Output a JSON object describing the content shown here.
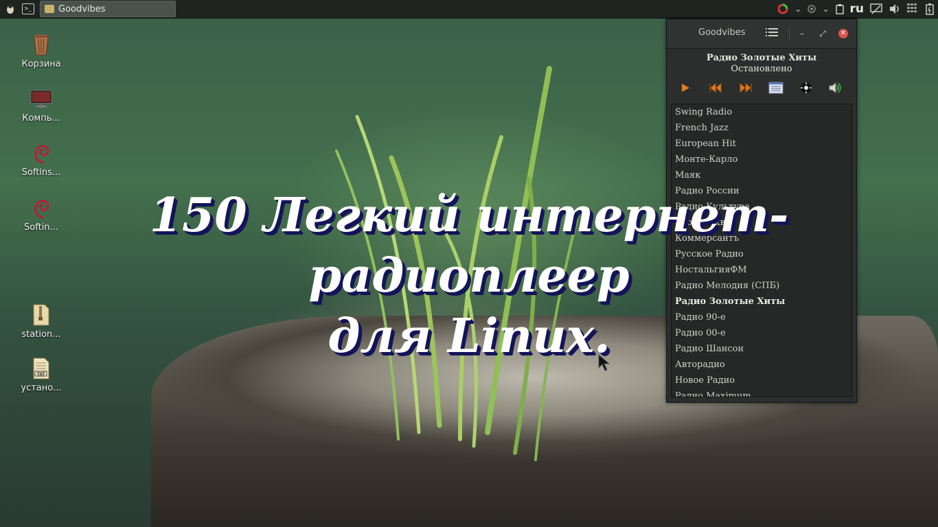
{
  "taskbar": {
    "window_title": "Goodvibes",
    "tray_lang": "ru"
  },
  "desktop": {
    "icons": [
      {
        "label": "Корзина"
      },
      {
        "label": "Компь..."
      },
      {
        "label": "Softins..."
      },
      {
        "label": "Softin..."
      },
      {
        "label": "station..."
      },
      {
        "label": "устано..."
      }
    ]
  },
  "overlay": {
    "line1": "150 Легкий интернет-радиоплеер",
    "line2": "для Linux."
  },
  "player": {
    "title": "Goodvibes",
    "current_station": "Радио Золотые Хиты",
    "status": "Остановлено",
    "icons": [
      "play-icon",
      "previous-icon",
      "next-icon",
      "stations-list-icon",
      "settings-icon",
      "volume-icon"
    ],
    "stations": [
      "Swing Radio",
      "French Jazz",
      "European Hit",
      "Монте-Карло",
      "Маяк",
      "Радио России",
      "Радио Культура",
      "Эхо Москвы",
      "Коммерсантъ",
      "Русское Радио",
      "НостальгияФМ",
      "Радио Мелодия (СПБ)",
      "Радио Золотые Хиты",
      "Радио 90-е",
      "Радио 00-е",
      "Радио Шансон",
      "Авторадио",
      "Новое Радио",
      "Радио Maximum"
    ],
    "active_index": 12
  }
}
